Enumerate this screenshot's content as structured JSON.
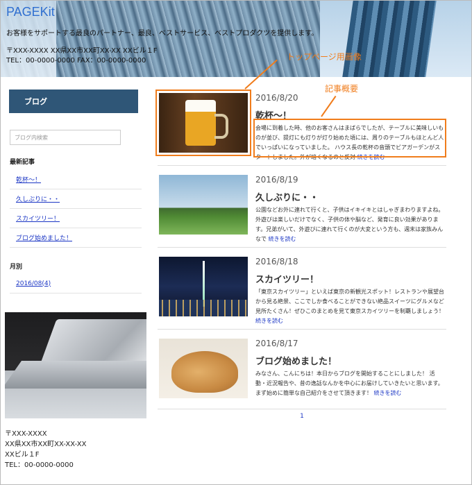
{
  "header": {
    "brand": "PAGEKit",
    "tagline": "お客様をサポートする最良のパートナー、最良、ベストサービス、ベストプロダクツを提供します。",
    "address_line": "〒XXX-XXXX XX県XX市XX町XX-XX XXビル１F",
    "tel_line": "TEL：00-0000-0000 FAX：00-0000-0000"
  },
  "annotations": {
    "top_image": "トップページ用画像",
    "summary": "記事概要"
  },
  "sidebar": {
    "blog_button": "ブログ",
    "search_placeholder": "ブログ内検索",
    "recent_heading": "最新記事",
    "recent": [
      "乾杯〜！",
      "久しぶりに・・",
      "スカイツリー！",
      "ブログ始めました！"
    ],
    "monthly_heading": "月別",
    "months": [
      "2016/08(4)"
    ]
  },
  "footer_address": {
    "zip": "〒XXX-XXXX",
    "street": "XX県XX市XX町XX-XX-XX",
    "building": "XXビル１F",
    "tel": "TEL：00-0000-0000"
  },
  "posts": [
    {
      "date": "2016/8/20",
      "title": "乾杯〜！",
      "excerpt": "会場に到着した時、他のお客さんはまばらでしたが、テーブルに美味しいものが並び、提灯にも灯りが灯り始めた頃には、周りのテーブルもほとんど人でいっぱいになっていました。 ハウス長の乾杯の音頭でビアガーデンがスタートしました。外が暗くなるのと反対",
      "more": "続きを読む"
    },
    {
      "date": "2016/8/19",
      "title": "久しぶりに・・",
      "excerpt": "公園などお外に連れて行くと、子供はイキイキとはしゃぎまわりますよね。外遊びは楽しいだけでなく、子供の体や脳など、発育に良い効果があります。兄弟がいて、外遊びに連れて行くのが大変という方も、週末は家族みんなで",
      "more": "続きを読む"
    },
    {
      "date": "2016/8/18",
      "title": "スカイツリー！",
      "excerpt": "「東京スカイツリー」といえば東京の新観光スポット！レストランや展望台から見る絶景、ここでしか食べることができない絶品スイーツにグルメなど見所たくさん！ぜひこのまとめを見て東京スカイツリーを制覇しましょう！",
      "more": "続きを読む"
    },
    {
      "date": "2016/8/17",
      "title": "ブログ始めました！",
      "excerpt": "みなさん、こんにちは！本日からブログを開始することにしました！ 活動・近況報告や、昔の逸話なんかを中心にお届けしていきたいと思います。まず始めに簡単な自己紹介をさせて頂きます！",
      "more": "続きを読む"
    }
  ],
  "pagination": {
    "page": "1"
  },
  "colors": {
    "accent": "#f07c1b",
    "button": "#2f5677",
    "link": "#1a35c4",
    "brand": "#2f6fd0"
  }
}
